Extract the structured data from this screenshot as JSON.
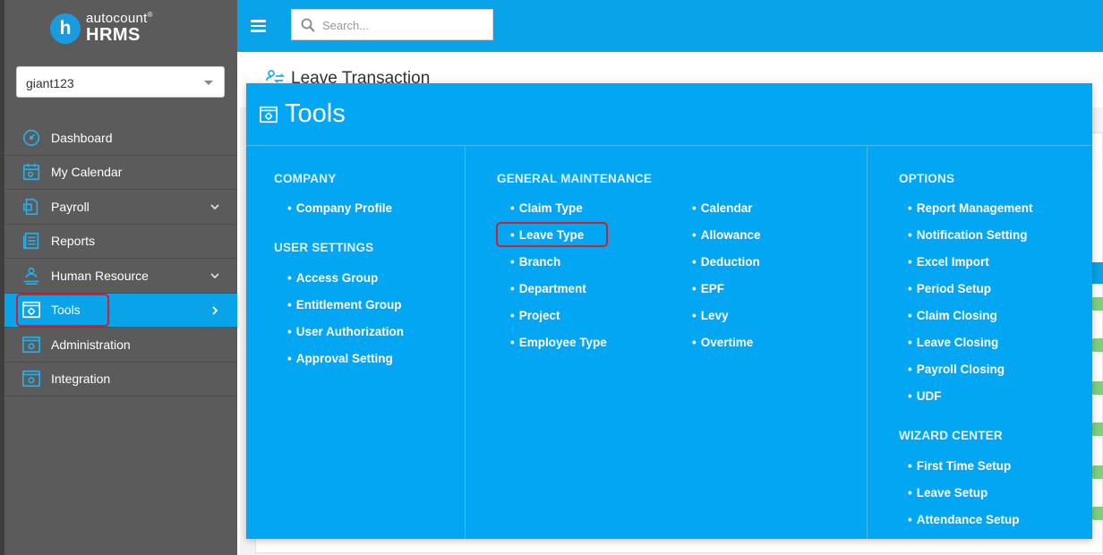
{
  "app": {
    "brand_small": "autocount",
    "brand_mark": "®",
    "brand_big": "HRMS",
    "brand_letter": "h"
  },
  "company_select": {
    "value": "giant123"
  },
  "search": {
    "placeholder": "Search..."
  },
  "page_title": "Leave Transaction",
  "sidebar": {
    "items": [
      {
        "label": "Dashboard",
        "icon": "dashboard-icon"
      },
      {
        "label": "My Calendar",
        "icon": "calendar-icon"
      },
      {
        "label": "Payroll",
        "icon": "payroll-icon"
      },
      {
        "label": "Reports",
        "icon": "reports-icon"
      },
      {
        "label": "Human Resource",
        "icon": "human-resource-icon"
      },
      {
        "label": "Tools",
        "icon": "tools-icon"
      },
      {
        "label": "Administration",
        "icon": "administration-icon"
      },
      {
        "label": "Integration",
        "icon": "integration-icon"
      }
    ]
  },
  "mega_menu": {
    "title": "Tools",
    "company": {
      "title": "COMPANY",
      "items": [
        "Company Profile"
      ]
    },
    "user_settings": {
      "title": "USER SETTINGS",
      "items": [
        "Access Group",
        "Entitlement Group",
        "User Authorization",
        "Approval Setting"
      ]
    },
    "general_maintenance": {
      "title": "GENERAL MAINTENANCE",
      "col_a": [
        "Claim Type",
        "Leave Type",
        "Branch",
        "Department",
        "Project",
        "Employee Type"
      ],
      "col_b": [
        "Calendar",
        "Allowance",
        "Deduction",
        "EPF",
        "Levy",
        "Overtime"
      ]
    },
    "options": {
      "title": "OPTIONS",
      "items": [
        "Report Management",
        "Notification Setting",
        "Excel Import",
        "Period Setup",
        "Claim Closing",
        "Leave Closing",
        "Payroll Closing",
        "UDF"
      ]
    },
    "wizard_center": {
      "title": "WIZARD CENTER",
      "items": [
        "First Time Setup",
        "Leave Setup",
        "Attendance Setup"
      ]
    }
  },
  "colors": {
    "accent": "#08a3e8",
    "menu_bg": "#03a6f3",
    "sidebar_bg": "#5b5b5b",
    "highlight": "#d11f2c"
  }
}
